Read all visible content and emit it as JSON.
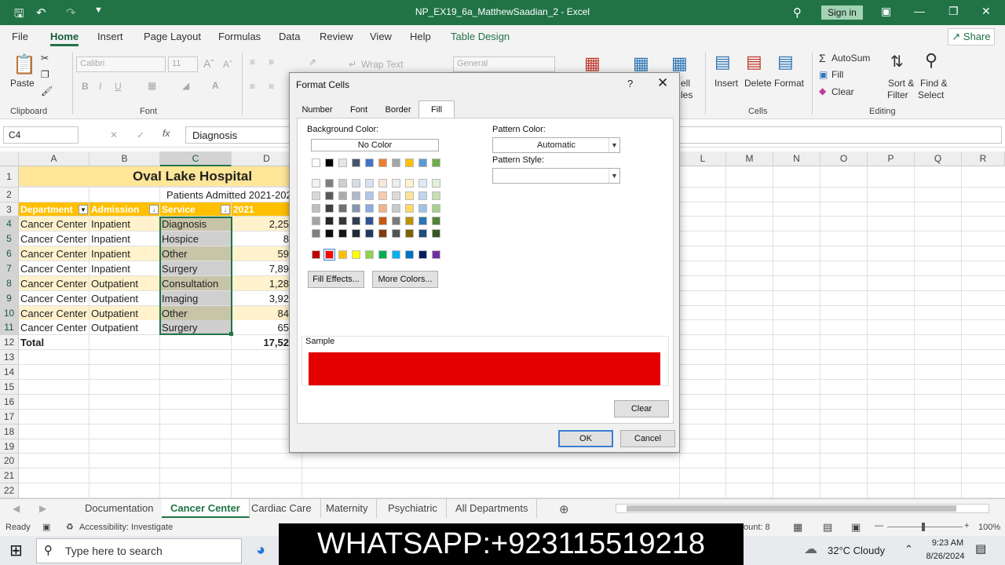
{
  "window": {
    "title": "NP_EX19_6a_MatthewSaadian_2 - Excel",
    "sign_in": "Sign in"
  },
  "menu": {
    "tabs": [
      "File",
      "Home",
      "Insert",
      "Page Layout",
      "Formulas",
      "Data",
      "Review",
      "View",
      "Help",
      "Table Design"
    ],
    "share": "Share"
  },
  "ribbon": {
    "paste": "Paste",
    "clipboard": "Clipboard",
    "font": "Font",
    "font_name": "Calibri",
    "font_size": "11",
    "wrap_text": "Wrap Text",
    "number_format": "General",
    "cells_partial": "ell",
    "styles_partial": "les",
    "insert": "Insert",
    "delete": "Delete",
    "format": "Format",
    "cells": "Cells",
    "autosum": "AutoSum",
    "fill": "Fill",
    "clear": "Clear",
    "sort_filter_1": "Sort &",
    "sort_filter_2": "Filter",
    "find_select_1": "Find &",
    "find_select_2": "Select",
    "editing": "Editing"
  },
  "formula_bar": {
    "name_box": "C4",
    "value": "Diagnosis"
  },
  "columns": [
    "A",
    "B",
    "C",
    "D",
    "L",
    "M",
    "N",
    "O",
    "P",
    "Q",
    "R"
  ],
  "rows": [
    "1",
    "2",
    "3",
    "4",
    "5",
    "6",
    "7",
    "8",
    "9",
    "10",
    "11",
    "12",
    "13",
    "14",
    "15",
    "16",
    "17",
    "18",
    "19",
    "20",
    "21",
    "22"
  ],
  "sheet": {
    "title": "Oval Lake Hospital",
    "subtitle": "Patients Admitted 2021-202",
    "headers": [
      "Department",
      "Admission",
      "Service",
      "2021"
    ],
    "data": [
      [
        "Cancer Center",
        "Inpatient",
        "Diagnosis",
        "2,25"
      ],
      [
        "Cancer Center",
        "Inpatient",
        "Hospice",
        "8"
      ],
      [
        "Cancer Center",
        "Inpatient",
        "Other",
        "59"
      ],
      [
        "Cancer Center",
        "Inpatient",
        "Surgery",
        "7,89"
      ],
      [
        "Cancer Center",
        "Outpatient",
        "Consultation",
        "1,28"
      ],
      [
        "Cancer Center",
        "Outpatient",
        "Imaging",
        "3,92"
      ],
      [
        "Cancer Center",
        "Outpatient",
        "Other",
        "84"
      ],
      [
        "Cancer Center",
        "Outpatient",
        "Surgery",
        "65"
      ]
    ],
    "total_label": "Total",
    "total_value": "17,52"
  },
  "sheet_tabs": [
    "Documentation",
    "Cancer Center",
    "Cardiac Care",
    "Maternity",
    "Psychiatric",
    "All Departments"
  ],
  "status": {
    "ready": "Ready",
    "accessibility": "Accessibility: Investigate",
    "count": "ount: 8",
    "zoom": "100%"
  },
  "taskbar": {
    "search": "Type here to search",
    "weather": "32°C  Cloudy",
    "time": "9:23 AM",
    "date": "8/26/2024"
  },
  "overlay": {
    "text": "WHATSAPP:+923115519218"
  },
  "dialog": {
    "title": "Format Cells",
    "help": "?",
    "tabs": [
      "Number",
      "Font",
      "Border",
      "Fill"
    ],
    "background_color": "Background Color:",
    "no_color": "No Color",
    "pattern_color": "Pattern Color:",
    "pattern_color_value": "Automatic",
    "pattern_style": "Pattern Style:",
    "fill_effects": "Fill Effects...",
    "more_colors": "More Colors...",
    "sample": "Sample",
    "clear": "Clear",
    "ok": "OK",
    "cancel": "Cancel",
    "sample_color": "#e30000",
    "theme_row": [
      "#ffffff",
      "#000000",
      "#e7e6e6",
      "#44546a",
      "#4472c4",
      "#ed7d31",
      "#a5a5a5",
      "#ffc000",
      "#5b9bd5",
      "#70ad47"
    ],
    "tints": [
      [
        "#f2f2f2",
        "#7f7f7f",
        "#d0cece",
        "#d6dce4",
        "#d9e2f3",
        "#fbe5d5",
        "#ededed",
        "#fff2cc",
        "#deebf6",
        "#e2efd9"
      ],
      [
        "#d8d8d8",
        "#595959",
        "#aeabab",
        "#adb9ca",
        "#b4c6e7",
        "#f7cbac",
        "#dbdbdb",
        "#fee599",
        "#bdd7ee",
        "#c5e0b3"
      ],
      [
        "#bfbfbf",
        "#3f3f3f",
        "#757070",
        "#8496b0",
        "#8eaadb",
        "#f4b183",
        "#c9c9c9",
        "#ffd965",
        "#9dc3e6",
        "#a8d08d"
      ],
      [
        "#a5a5a5",
        "#262626",
        "#3a3838",
        "#323f4f",
        "#2f5496",
        "#c55a11",
        "#7b7b7b",
        "#bf9000",
        "#2e75b5",
        "#538135"
      ],
      [
        "#7f7f7f",
        "#0c0c0c",
        "#171616",
        "#222a35",
        "#1f3864",
        "#833c0b",
        "#525252",
        "#7f6000",
        "#1e4e79",
        "#375623"
      ]
    ],
    "standard": [
      "#c00000",
      "#ff0000",
      "#ffc000",
      "#ffff00",
      "#92d050",
      "#00b050",
      "#00b0f0",
      "#0070c0",
      "#002060",
      "#7030a0"
    ]
  }
}
